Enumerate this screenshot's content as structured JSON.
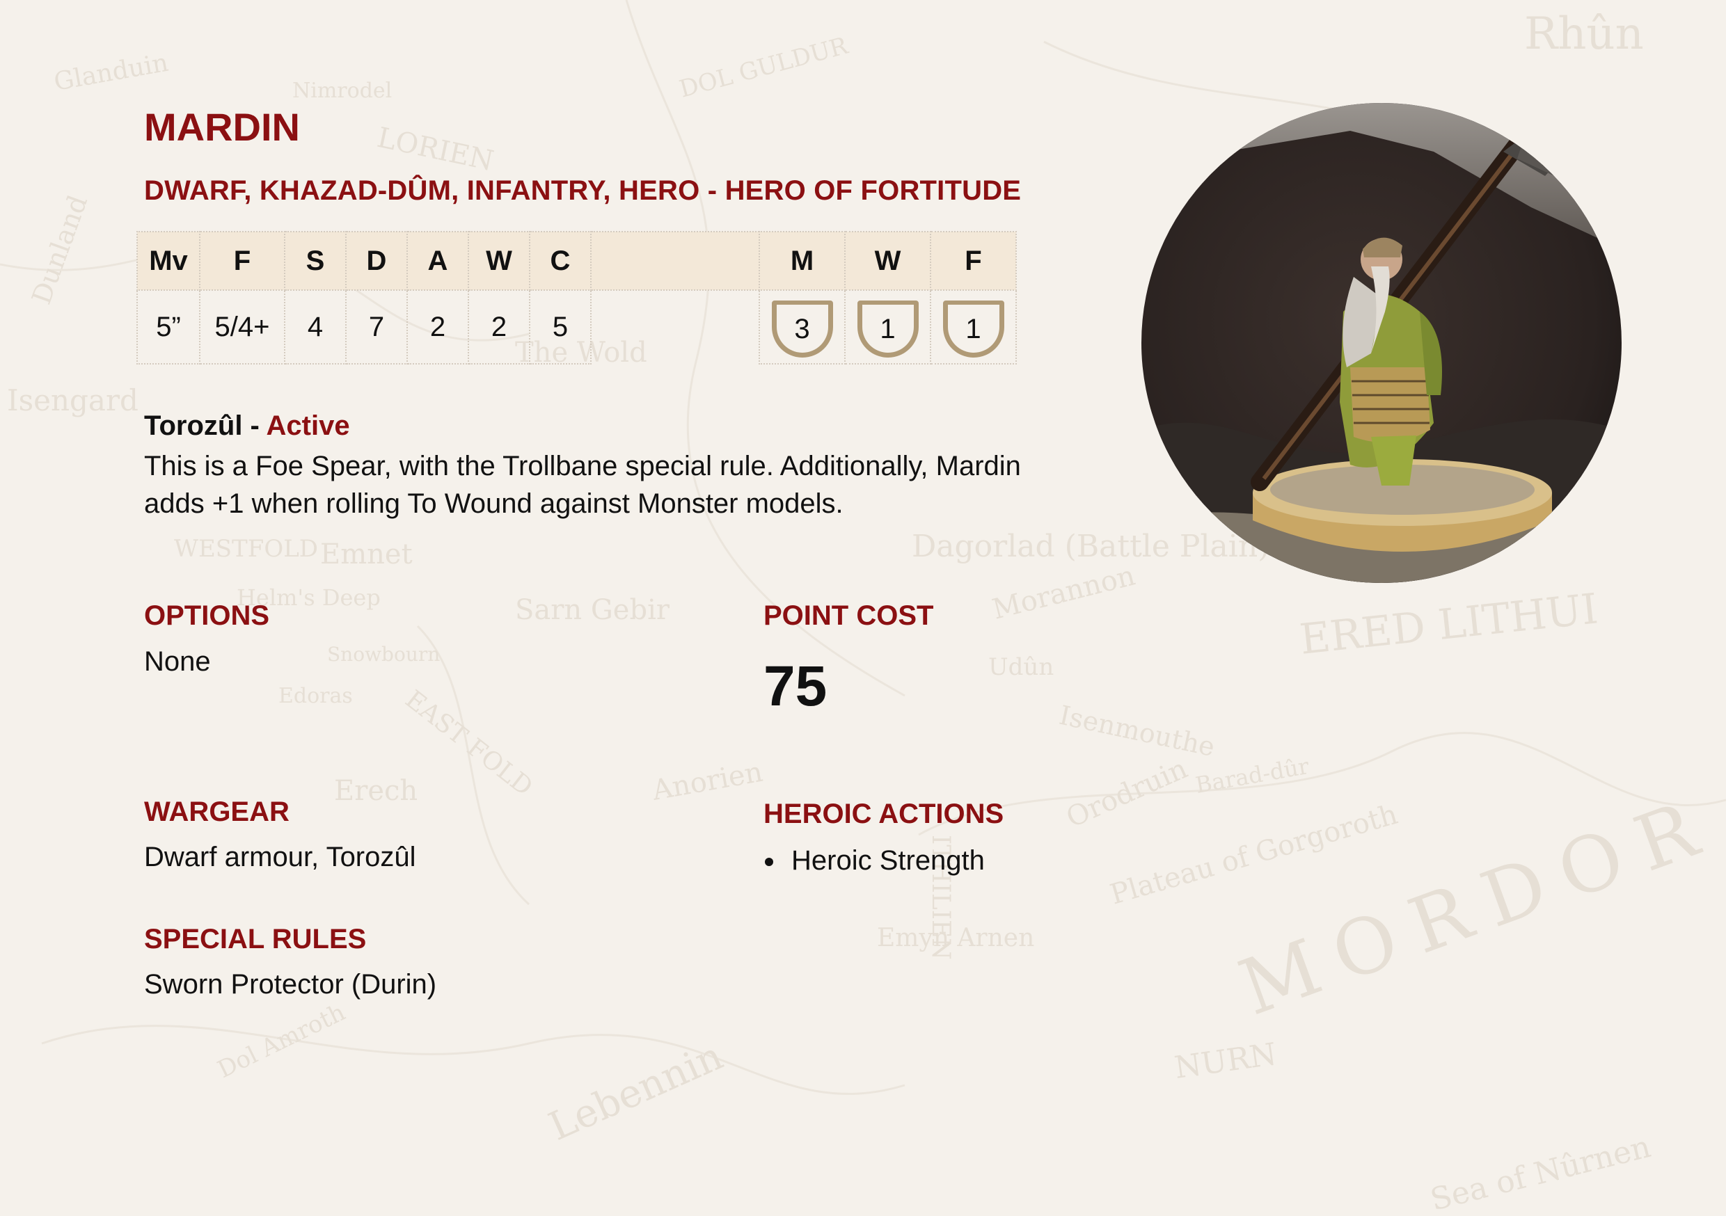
{
  "background_map": {
    "labels": [
      "Rhûn",
      "LORIEN",
      "Isengard",
      "WESTFOLD",
      "Emnet",
      "Dagorlad (Battle Plain)",
      "EAST FOLD",
      "ERED LITHUI",
      "Morannon",
      "Udûn",
      "Isenmouthe",
      "Barad-dûr",
      "Orodruin",
      "Plateau of Gorgoroth",
      "MORDOR",
      "NURN",
      "Sea of Nûrnen",
      "Sarn Gebir",
      "Anorien",
      "Erech",
      "Lebennin",
      "Emyn Arnen",
      "ITHILIEN",
      "Dol Amroth",
      "Snowbourn",
      "Edoras",
      "Helm's Deep",
      "The Wold",
      "Glanduin",
      "Nimrodel",
      "Dunland",
      "DOL GULDUR"
    ]
  },
  "profile": {
    "name": "MARDIN",
    "keywords": "DWARF, KHAZAD-DÛM, INFANTRY, HERO - HERO OF FORTITUDE",
    "stat_headers": [
      "Mv",
      "F",
      "S",
      "D",
      "A",
      "W",
      "C"
    ],
    "stat_values": [
      "5”",
      "5/4+",
      "4",
      "7",
      "2",
      "2",
      "5"
    ],
    "heroic_headers": [
      "M",
      "W",
      "F"
    ],
    "heroic_values": [
      "3",
      "1",
      "1"
    ],
    "shield_color": "#b09a76",
    "header_bg": "#f3e8d8",
    "accent": "#8b1012"
  },
  "rule": {
    "name": "Torozûl - ",
    "type": "Active",
    "text": "This is a Foe Spear, with the Trollbane special rule. Additionally, Mardin adds +1 when rolling To Wound against Monster models."
  },
  "sections": {
    "options_title": "OPTIONS",
    "options_text": "None",
    "point_cost_title": "POINT COST",
    "point_cost_value": "75",
    "wargear_title": "WARGEAR",
    "wargear_text": "Dwarf armour, Torozûl",
    "heroic_actions_title": "HEROIC ACTIONS",
    "heroic_actions": [
      "Heroic Strength"
    ],
    "special_rules_title": "SPECIAL RULES",
    "special_rules_text": "Sworn Protector (Durin)"
  },
  "portrait": {
    "icon": "dwarf-miniature-image"
  }
}
